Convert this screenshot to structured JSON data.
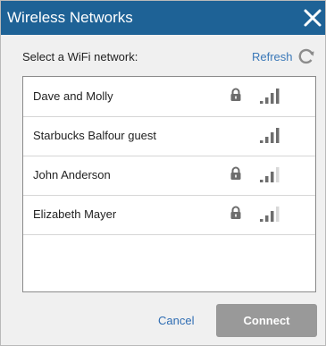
{
  "window": {
    "title": "Wireless Networks",
    "close_icon": "close-x-icon"
  },
  "header": {
    "prompt": "Select a WiFi network:",
    "refresh_label": "Refresh",
    "refresh_icon": "refresh-icon"
  },
  "networks": [
    {
      "name": "Dave and Molly",
      "secured": true,
      "signal_bars": 4
    },
    {
      "name": "Starbucks Balfour guest",
      "secured": false,
      "signal_bars": 4
    },
    {
      "name": "John Anderson",
      "secured": true,
      "signal_bars": 3
    },
    {
      "name": "Elizabeth Mayer",
      "secured": true,
      "signal_bars": 3
    }
  ],
  "footer": {
    "cancel_label": "Cancel",
    "connect_label": "Connect"
  },
  "colors": {
    "titlebar": "#1e6296",
    "dialog_bg": "#f0f0f0",
    "link": "#3a78b8",
    "connect_disabled": "#999999",
    "icon_gray": "#6d6d6d"
  }
}
